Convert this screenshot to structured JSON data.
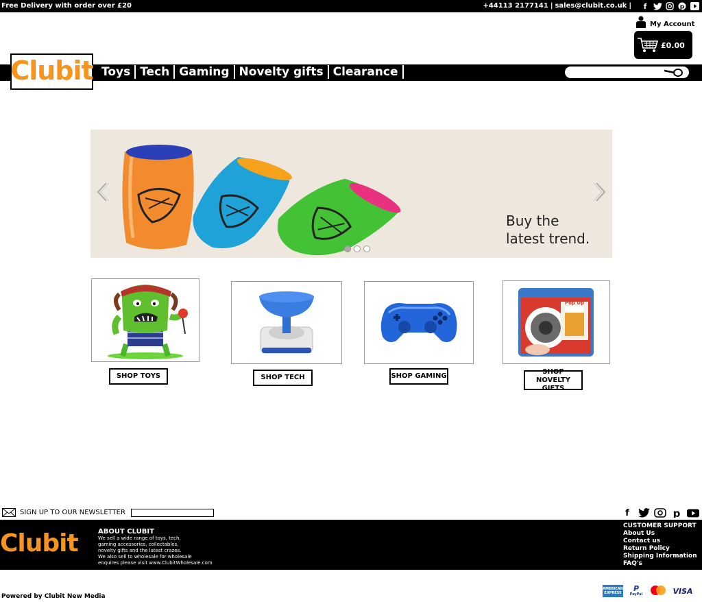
{
  "topbar": {
    "promo": "Free Delivery with order over  £20",
    "phone": "+44113 2177141",
    "email": "sales@clubit.co.uk",
    "social": [
      "facebook-icon",
      "twitter-icon",
      "instagram-icon",
      "pinterest-icon",
      "youtube-icon"
    ]
  },
  "account": {
    "label": "My Account"
  },
  "cart": {
    "total": "£0.00"
  },
  "logo": {
    "text": "Clubit"
  },
  "nav": {
    "items": [
      "Toys",
      "Tech",
      "Gaming",
      "Novelty gifts",
      "Clearance"
    ]
  },
  "search": {
    "placeholder": ""
  },
  "slider": {
    "caption_line1": "Buy the",
    "caption_line2": "latest trend.",
    "slide_count": 3,
    "active_slide": 1
  },
  "categories": [
    {
      "button": "SHOP TOYS"
    },
    {
      "button": "SHOP TECH"
    },
    {
      "button": "SHOP GAMING"
    },
    {
      "button": "SHOP NOVELTY GIFTS"
    }
  ],
  "newsletter": {
    "label": "SIGN UP TO OUR NEWSLETTER"
  },
  "footer": {
    "logo_text": "Clubit",
    "about_title": "ABOUT CLUBIT",
    "about_lines": [
      "We sell a wide range of toys, tech,",
      "gaming accessories, collectables,",
      "novelty gifts and the latest crazes.",
      "We also sell to wholesale for wholesale",
      "enquires please visit www.ClubitWholesale.com"
    ],
    "support_title": "CUSTOMER SUPPORT",
    "support_links": [
      "About Us",
      "Contact us",
      "Return Policy",
      "Shipping Information",
      "FAQ's"
    ]
  },
  "powered_by": "Powered by Clubit New Media",
  "payments": [
    "AMERICAN EXPRESS",
    "PayPal",
    "mastercard",
    "VISA"
  ],
  "colors": {
    "brand_orange": "#f7941d",
    "bar": "#000000",
    "slider_bg": "#ede7dd"
  }
}
